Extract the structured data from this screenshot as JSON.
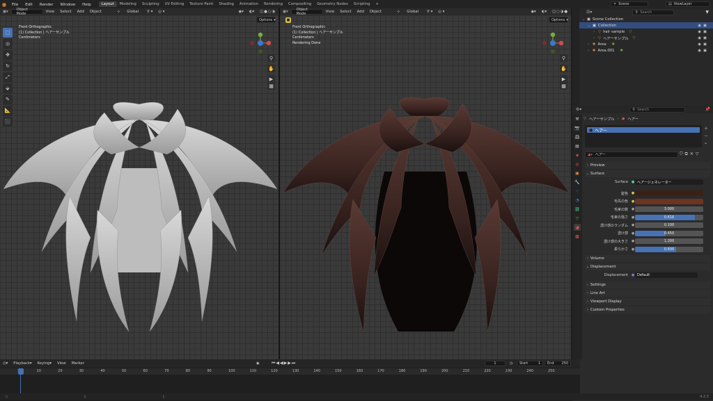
{
  "app": {
    "menu": [
      "File",
      "Edit",
      "Render",
      "Window",
      "Help"
    ],
    "workspaces": [
      "Layout",
      "Modeling",
      "Sculpting",
      "UV Editing",
      "Texture Paint",
      "Shading",
      "Animation",
      "Rendering",
      "Compositing",
      "Geometry Nodes",
      "Scripting"
    ],
    "active_workspace": "Layout",
    "scene": "Scene",
    "view_layer": "ViewLayer",
    "add_tab": "+"
  },
  "viewport_left": {
    "mode": "Object Mode",
    "menus": [
      "View",
      "Select",
      "Add",
      "Object"
    ],
    "transform": "Global",
    "options": "Options",
    "info": [
      "Front Orthographic",
      "(1) Collection | ヘアーサンプル",
      "Centimeters"
    ]
  },
  "viewport_right": {
    "mode": "Object Mode",
    "menus": [
      "View",
      "Select",
      "Add",
      "Object"
    ],
    "transform": "Global",
    "options": "Options",
    "info": [
      "Front Orthographic",
      "(1) Collection | ヘアーサンプル",
      "Centimeters",
      "Rendering Done"
    ]
  },
  "outliner": {
    "search_placeholder": "Search",
    "rows": [
      {
        "label": "Scene Collection",
        "indent": 0,
        "icon": "collection-icon"
      },
      {
        "label": "Collection",
        "indent": 1,
        "icon": "collection-icon",
        "selected": true
      },
      {
        "label": "hair sample",
        "indent": 2,
        "icon": "object-icon"
      },
      {
        "label": "ヘアーサンプル",
        "indent": 2,
        "icon": "hair-icon"
      },
      {
        "label": "Area",
        "indent": 1,
        "icon": "light-icon"
      },
      {
        "label": "Area.001",
        "indent": 1,
        "icon": "light-icon"
      }
    ]
  },
  "properties": {
    "search_placeholder": "Search",
    "breadcrumb": [
      "ヘアーサンプル",
      "ヘアー"
    ],
    "material_slot": "ヘアー",
    "material_name": "ヘアー",
    "sections": {
      "preview": "Preview",
      "surface": "Surface",
      "volume": "Volume",
      "displacement": "Displacement",
      "settings": "Settings",
      "line_art": "Line Art",
      "viewport_display": "Viewport Display",
      "custom_properties": "Custom Properties"
    },
    "surface_label": "Surface",
    "surface_value": "ヘアージェネレーター",
    "rows": [
      {
        "label": "髪色",
        "value": "",
        "type": "color",
        "color": "#3a2116"
      },
      {
        "label": "毛先の色",
        "value": "",
        "type": "color",
        "color": "#6b3520"
      },
      {
        "label": "毛束の数",
        "value": "3.000",
        "type": "num",
        "fill": 0
      },
      {
        "label": "毛束の強さ",
        "value": "0.616",
        "type": "num",
        "fill": 0.88
      },
      {
        "label": "透け感のランダム",
        "value": "0.100",
        "type": "num",
        "fill": 0
      },
      {
        "label": "透け感",
        "value": "0.450",
        "type": "num",
        "fill": 0.45
      },
      {
        "label": "透け感の大きさ",
        "value": "1.200",
        "type": "num",
        "fill": 0
      },
      {
        "label": "柔らかさ",
        "value": "0.600",
        "type": "num",
        "fill": 0.6
      }
    ],
    "displacement_label": "Displacement",
    "displacement_value": "Default"
  },
  "timeline": {
    "menus": [
      "Playback",
      "Keying",
      "View",
      "Marker"
    ],
    "current": "1",
    "start_label": "Start",
    "start": "1",
    "end_label": "End",
    "end": "250",
    "ticks": [
      "1",
      "10",
      "20",
      "30",
      "40",
      "50",
      "60",
      "70",
      "80",
      "90",
      "100",
      "110",
      "120",
      "130",
      "140",
      "150",
      "160",
      "170",
      "180",
      "190",
      "200",
      "210",
      "220",
      "230",
      "240",
      "250"
    ]
  },
  "version": "4.2.3"
}
